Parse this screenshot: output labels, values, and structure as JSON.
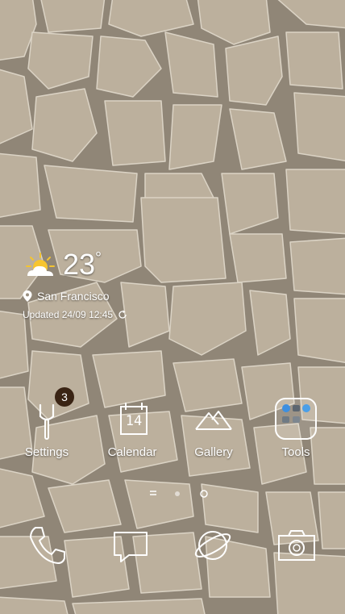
{
  "weather": {
    "temperature": "23",
    "unit": "°",
    "city": "San Francisco",
    "updated": "Updated 24/09 12:45",
    "icon": "sun-cloud-icon"
  },
  "apps": [
    {
      "label": "Settings",
      "icon": "settings-icon",
      "badge": "3"
    },
    {
      "label": "Calendar",
      "icon": "calendar-icon",
      "day": "14"
    },
    {
      "label": "Gallery",
      "icon": "gallery-icon"
    },
    {
      "label": "Tools",
      "icon": "tools-folder-icon"
    }
  ],
  "page_indicator": {
    "pages": 3,
    "current": 1
  },
  "dock": [
    {
      "icon": "phone-icon"
    },
    {
      "icon": "messages-icon"
    },
    {
      "icon": "browser-icon"
    },
    {
      "icon": "camera-icon"
    }
  ],
  "colors": {
    "badge": "#3a2414",
    "text": "#ffffff",
    "stone": "#c9bda8",
    "grout": "#8c8273"
  }
}
